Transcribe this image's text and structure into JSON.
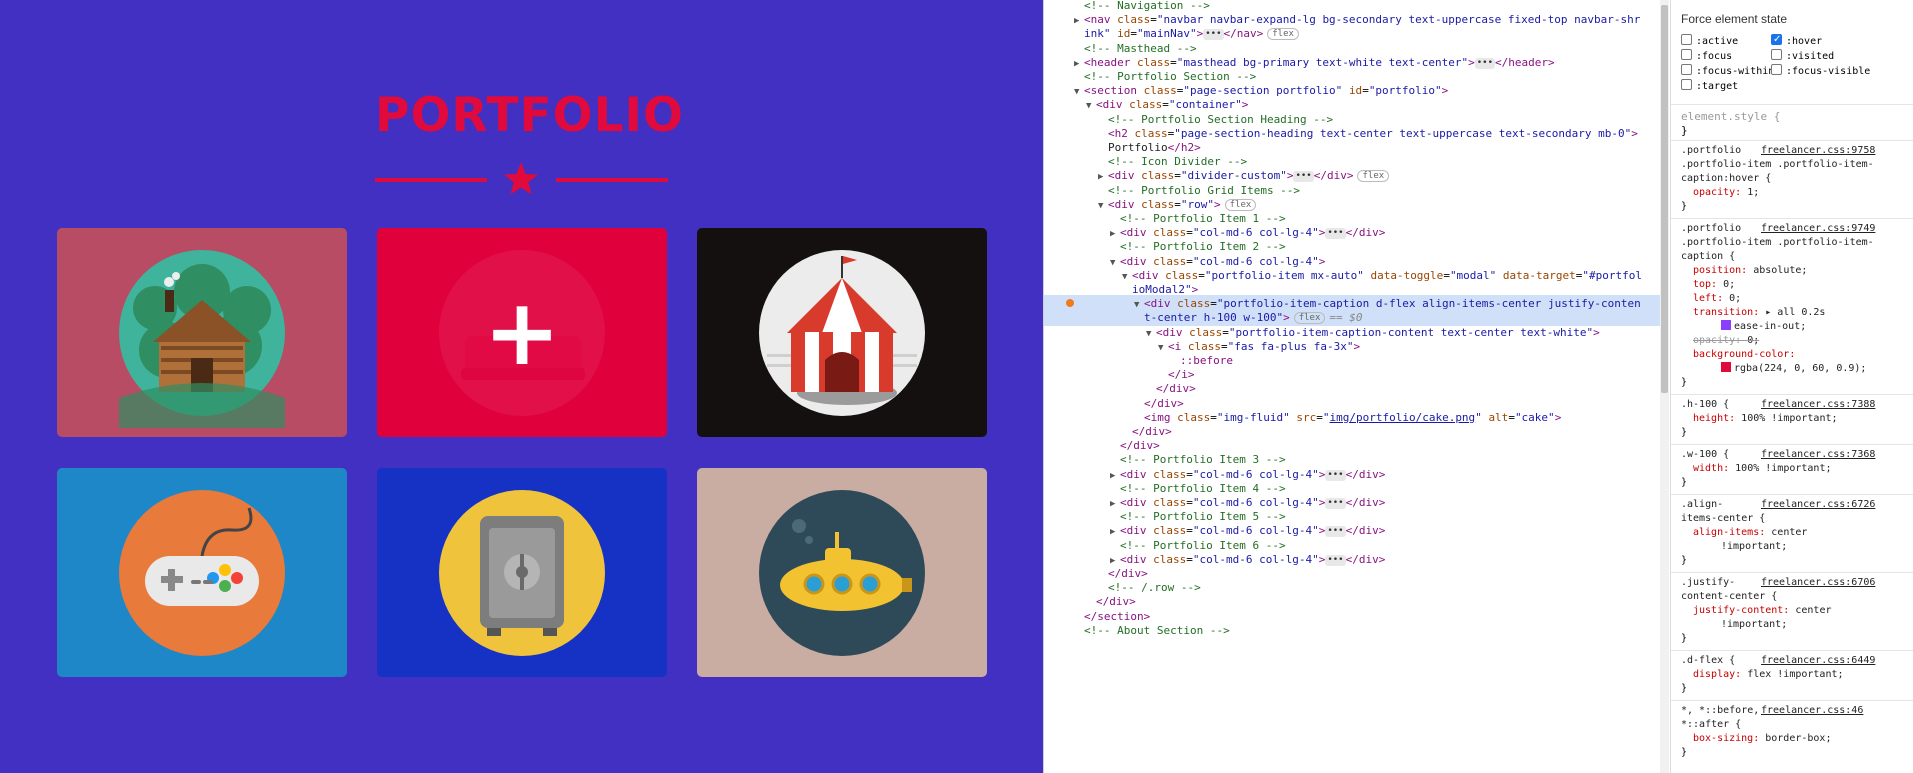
{
  "page": {
    "title": "PORTFOLIO",
    "colors": {
      "background": "#4130c1",
      "accent": "#e00a3c",
      "overlay": "rgba(224, 0, 60, 0.9)"
    },
    "portfolio_items": [
      {
        "name": "cabin",
        "bg": "#b74c64"
      },
      {
        "name": "cake",
        "bg": "#e00a3c",
        "hovered": true
      },
      {
        "name": "circus",
        "bg": "#141010"
      },
      {
        "name": "game",
        "bg": "#1e87c8"
      },
      {
        "name": "safe",
        "bg": "#1532c4"
      },
      {
        "name": "submarine",
        "bg": "#c9ada3"
      }
    ],
    "overlay_icon": "plus-icon"
  },
  "devtools": {
    "dom_lines": [
      {
        "indent": 1,
        "tri": "",
        "html": "<span class='c'>&lt;!-- Navigation --&gt;</span>"
      },
      {
        "indent": 1,
        "tri": "▶",
        "html": "<span class='t'>&lt;nav</span> <span class='an'>class</span>=<span class='av'>\"navbar navbar-expand-lg bg-secondary text-uppercase fixed-top navbar-shr</span>"
      },
      {
        "indent": 1,
        "tri": "",
        "html": "<span class='av'>ink\"</span> <span class='an'>id</span>=<span class='av'>\"mainNav\"</span><span class='t'>&gt;</span><span class='ell'>•••</span><span class='t'>&lt;/nav&gt;</span><span class='badge'>flex</span>"
      },
      {
        "indent": 1,
        "tri": "",
        "html": "<span class='c'>&lt;!-- Masthead --&gt;</span>"
      },
      {
        "indent": 1,
        "tri": "▶",
        "html": "<span class='t'>&lt;header</span> <span class='an'>class</span>=<span class='av'>\"masthead bg-primary text-white text-center\"</span><span class='t'>&gt;</span><span class='ell'>•••</span><span class='t'>&lt;/header&gt;</span>"
      },
      {
        "indent": 1,
        "tri": "",
        "html": "<span class='c'>&lt;!-- Portfolio Section --&gt;</span>"
      },
      {
        "indent": 1,
        "tri": "▼",
        "html": "<span class='t'>&lt;section</span> <span class='an'>class</span>=<span class='av'>\"page-section portfolio\"</span> <span class='an'>id</span>=<span class='av'>\"portfolio\"</span><span class='t'>&gt;</span>"
      },
      {
        "indent": 2,
        "tri": "▼",
        "html": "<span class='t'>&lt;div</span> <span class='an'>class</span>=<span class='av'>\"container\"</span><span class='t'>&gt;</span>"
      },
      {
        "indent": 3,
        "tri": "",
        "html": "<span class='c'>&lt;!-- Portfolio Section Heading --&gt;</span>"
      },
      {
        "indent": 3,
        "tri": "",
        "html": "<span class='t'>&lt;h2</span> <span class='an'>class</span>=<span class='av'>\"page-section-heading text-center text-uppercase text-secondary mb-0\"</span><span class='t'>&gt;</span>"
      },
      {
        "indent": 3,
        "tri": "",
        "html": "<span class='tx'>Portfolio</span><span class='t'>&lt;/h2&gt;</span>"
      },
      {
        "indent": 3,
        "tri": "",
        "html": "<span class='c'>&lt;!-- Icon Divider --&gt;</span>"
      },
      {
        "indent": 3,
        "tri": "▶",
        "html": "<span class='t'>&lt;div</span> <span class='an'>class</span>=<span class='av'>\"divider-custom\"</span><span class='t'>&gt;</span><span class='ell'>•••</span><span class='t'>&lt;/div&gt;</span><span class='badge'>flex</span>"
      },
      {
        "indent": 3,
        "tri": "",
        "html": "<span class='c'>&lt;!-- Portfolio Grid Items --&gt;</span>"
      },
      {
        "indent": 3,
        "tri": "▼",
        "html": "<span class='t'>&lt;div</span> <span class='an'>class</span>=<span class='av'>\"row\"</span><span class='t'>&gt;</span><span class='badge'>flex</span>"
      },
      {
        "indent": 4,
        "tri": "",
        "html": "<span class='c'>&lt;!-- Portfolio Item 1 --&gt;</span>"
      },
      {
        "indent": 4,
        "tri": "▶",
        "html": "<span class='t'>&lt;div</span> <span class='an'>class</span>=<span class='av'>\"col-md-6 col-lg-4\"</span><span class='t'>&gt;</span><span class='ell'>•••</span><span class='t'>&lt;/div&gt;</span>"
      },
      {
        "indent": 4,
        "tri": "",
        "html": "<span class='c'>&lt;!-- Portfolio Item 2 --&gt;</span>"
      },
      {
        "indent": 4,
        "tri": "▼",
        "html": "<span class='t'>&lt;div</span> <span class='an'>class</span>=<span class='av'>\"col-md-6 col-lg-4\"</span><span class='t'>&gt;</span>"
      },
      {
        "indent": 5,
        "tri": "▼",
        "html": "<span class='t'>&lt;div</span> <span class='an'>class</span>=<span class='av'>\"portfolio-item mx-auto\"</span> <span class='an'>data-toggle</span>=<span class='av'>\"modal\"</span> <span class='an'>data-target</span>=<span class='av'>\"#portfol</span>"
      },
      {
        "indent": 5,
        "tri": "",
        "html": "<span class='av'>ioModal2\"</span><span class='t'>&gt;</span>"
      },
      {
        "indent": 6,
        "tri": "▼",
        "sel": true,
        "html": "<span class='t'>&lt;div</span> <span class='an'>class</span>=<span class='av'>\"portfolio-item-caption d-flex align-items-center justify-conten</span>"
      },
      {
        "indent": 6,
        "tri": "",
        "sel": true,
        "html": "<span class='av'>t-center h-100 w-100\"</span><span class='t'>&gt;</span><span class='badge'>flex</span><span class='eq'>== $0</span>"
      },
      {
        "indent": 7,
        "tri": "▼",
        "html": "<span class='t'>&lt;div</span> <span class='an'>class</span>=<span class='av'>\"portfolio-item-caption-content text-center text-white\"</span><span class='t'>&gt;</span>"
      },
      {
        "indent": 8,
        "tri": "▼",
        "html": "<span class='t'>&lt;i</span> <span class='an'>class</span>=<span class='av'>\"fas fa-plus fa-3x\"</span><span class='t'>&gt;</span>"
      },
      {
        "indent": 9,
        "tri": "",
        "html": "<span class='t'>::before</span>"
      },
      {
        "indent": 8,
        "tri": "",
        "html": "<span class='t'>&lt;/i&gt;</span>"
      },
      {
        "indent": 7,
        "tri": "",
        "html": "<span class='t'>&lt;/div&gt;</span>"
      },
      {
        "indent": 6,
        "tri": "",
        "html": "<span class='t'>&lt;/div&gt;</span>"
      },
      {
        "indent": 6,
        "tri": "",
        "html": "<span class='t'>&lt;img</span> <span class='an'>class</span>=<span class='av'>\"img-fluid\"</span> <span class='an'>src</span>=<span class='av'>\"</span><span class='link'>img/portfolio/cake.png</span><span class='av'>\"</span> <span class='an'>alt</span>=<span class='av'>\"cake\"</span><span class='t'>&gt;</span>"
      },
      {
        "indent": 5,
        "tri": "",
        "html": "<span class='t'>&lt;/div&gt;</span>"
      },
      {
        "indent": 4,
        "tri": "",
        "html": "<span class='t'>&lt;/div&gt;</span>"
      },
      {
        "indent": 4,
        "tri": "",
        "html": "<span class='c'>&lt;!-- Portfolio Item 3 --&gt;</span>"
      },
      {
        "indent": 4,
        "tri": "▶",
        "html": "<span class='t'>&lt;div</span> <span class='an'>class</span>=<span class='av'>\"col-md-6 col-lg-4\"</span><span class='t'>&gt;</span><span class='ell'>•••</span><span class='t'>&lt;/div&gt;</span>"
      },
      {
        "indent": 4,
        "tri": "",
        "html": "<span class='c'>&lt;!-- Portfolio Item 4 --&gt;</span>"
      },
      {
        "indent": 4,
        "tri": "▶",
        "html": "<span class='t'>&lt;div</span> <span class='an'>class</span>=<span class='av'>\"col-md-6 col-lg-4\"</span><span class='t'>&gt;</span><span class='ell'>•••</span><span class='t'>&lt;/div&gt;</span>"
      },
      {
        "indent": 4,
        "tri": "",
        "html": "<span class='c'>&lt;!-- Portfolio Item 5 --&gt;</span>"
      },
      {
        "indent": 4,
        "tri": "▶",
        "html": "<span class='t'>&lt;div</span> <span class='an'>class</span>=<span class='av'>\"col-md-6 col-lg-4\"</span><span class='t'>&gt;</span><span class='ell'>•••</span><span class='t'>&lt;/div&gt;</span>"
      },
      {
        "indent": 4,
        "tri": "",
        "html": "<span class='c'>&lt;!-- Portfolio Item 6 --&gt;</span>"
      },
      {
        "indent": 4,
        "tri": "▶",
        "html": "<span class='t'>&lt;div</span> <span class='an'>class</span>=<span class='av'>\"col-md-6 col-lg-4\"</span><span class='t'>&gt;</span><span class='ell'>•••</span><span class='t'>&lt;/div&gt;</span>"
      },
      {
        "indent": 3,
        "tri": "",
        "html": "<span class='t'>&lt;/div&gt;</span>"
      },
      {
        "indent": 3,
        "tri": "",
        "html": "<span class='c'>&lt;!-- /.row --&gt;</span>"
      },
      {
        "indent": 2,
        "tri": "",
        "html": "<span class='t'>&lt;/div&gt;</span>"
      },
      {
        "indent": 1,
        "tri": "",
        "html": "<span class='t'>&lt;/section&gt;</span>"
      },
      {
        "indent": 1,
        "tri": "",
        "html": "<span class='c'>&lt;!-- About Section --&gt;</span>"
      }
    ],
    "styles": {
      "force_state_title": "Force element state",
      "states": [
        {
          "label": ":active",
          "checked": false
        },
        {
          "label": ":hover",
          "checked": true
        },
        {
          "label": ":focus",
          "checked": false
        },
        {
          "label": ":visited",
          "checked": false
        },
        {
          "label": ":focus-within",
          "checked": false
        },
        {
          "label": ":focus-visible",
          "checked": false
        },
        {
          "label": ":target",
          "checked": false
        }
      ],
      "element_style": "element.style {",
      "close_brace": "}",
      "rules": [
        {
          "selector": [
            ".portfolio",
            ".portfolio-item .portfolio-item-",
            "caption:hover {"
          ],
          "file": "freelancer.css:9758",
          "props": [
            {
              "p": "opacity",
              "v": "1;"
            }
          ]
        },
        {
          "selector": [
            ".portfolio",
            ".portfolio-item .portfolio-item-",
            "caption {"
          ],
          "file": "freelancer.css:9749",
          "props": [
            {
              "p": "position",
              "v": "absolute;"
            },
            {
              "p": "top",
              "v": "0;"
            },
            {
              "p": "left",
              "v": "0;"
            },
            {
              "p": "transition",
              "v": "▸ all 0.2s"
            },
            {
              "p": "",
              "v": "ease-in-out;",
              "swatch": "#8a3ffc"
            },
            {
              "p": "opacity",
              "v": "0;",
              "strike": true
            },
            {
              "p": "background-color",
              "v": ""
            },
            {
              "p": "",
              "v": "rgba(224, 0, 60, 0.9);",
              "swatch": "#e00a3c"
            }
          ]
        },
        {
          "selector": [
            ".h-100 {"
          ],
          "file": "freelancer.css:7388",
          "props": [
            {
              "p": "height",
              "v": "100% !important;"
            }
          ]
        },
        {
          "selector": [
            ".w-100 {"
          ],
          "file": "freelancer.css:7368",
          "props": [
            {
              "p": "width",
              "v": "100% !important;"
            }
          ]
        },
        {
          "selector": [
            ".align-",
            "items-center {"
          ],
          "file": "freelancer.css:6726",
          "props": [
            {
              "p": "align-items",
              "v": "center"
            },
            {
              "p": "",
              "v": "!important;"
            }
          ]
        },
        {
          "selector": [
            ".justify-",
            "content-center {"
          ],
          "file": "freelancer.css:6706",
          "props": [
            {
              "p": "justify-content",
              "v": "center"
            },
            {
              "p": "",
              "v": "!important;"
            }
          ]
        },
        {
          "selector": [
            ".d-flex {"
          ],
          "file": "freelancer.css:6449",
          "props": [
            {
              "p": "display",
              "v": "flex !important;"
            }
          ]
        },
        {
          "selector": [
            "*, *::before,",
            "*::after {"
          ],
          "file": "freelancer.css:46",
          "props": [
            {
              "p": "box-sizing",
              "v": "border-box;"
            }
          ]
        }
      ]
    }
  }
}
